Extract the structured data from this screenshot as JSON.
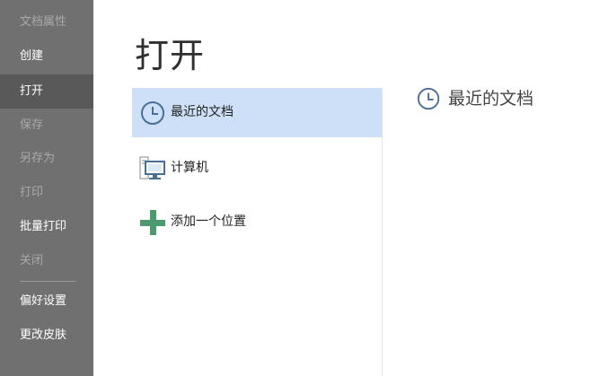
{
  "sidebar": {
    "items": [
      {
        "label": "文档属性",
        "state": "disabled"
      },
      {
        "label": "创建",
        "state": "normal"
      },
      {
        "label": "打开",
        "state": "active"
      },
      {
        "label": "保存",
        "state": "disabled"
      },
      {
        "label": "另存为",
        "state": "disabled"
      },
      {
        "label": "打印",
        "state": "disabled"
      },
      {
        "label": "批量打印",
        "state": "normal"
      },
      {
        "label": "关闭",
        "state": "disabled"
      },
      {
        "label": "偏好设置",
        "state": "normal"
      },
      {
        "label": "更改皮肤",
        "state": "normal"
      }
    ]
  },
  "main": {
    "title": "打开",
    "options": [
      {
        "label": "最近的文档",
        "icon": "clock-icon",
        "selected": true
      },
      {
        "label": "计算机",
        "icon": "computer-icon",
        "selected": false
      },
      {
        "label": "添加一个位置",
        "icon": "plus-icon",
        "selected": false
      }
    ],
    "detail": {
      "title": "最近的文档",
      "icon": "clock-icon"
    }
  },
  "colors": {
    "sidebar_bg": "#707070",
    "sidebar_active": "#595959",
    "selection": "#cde0f7",
    "icon_blue": "#4a6f95",
    "plus_green": "#4c9a6e"
  }
}
